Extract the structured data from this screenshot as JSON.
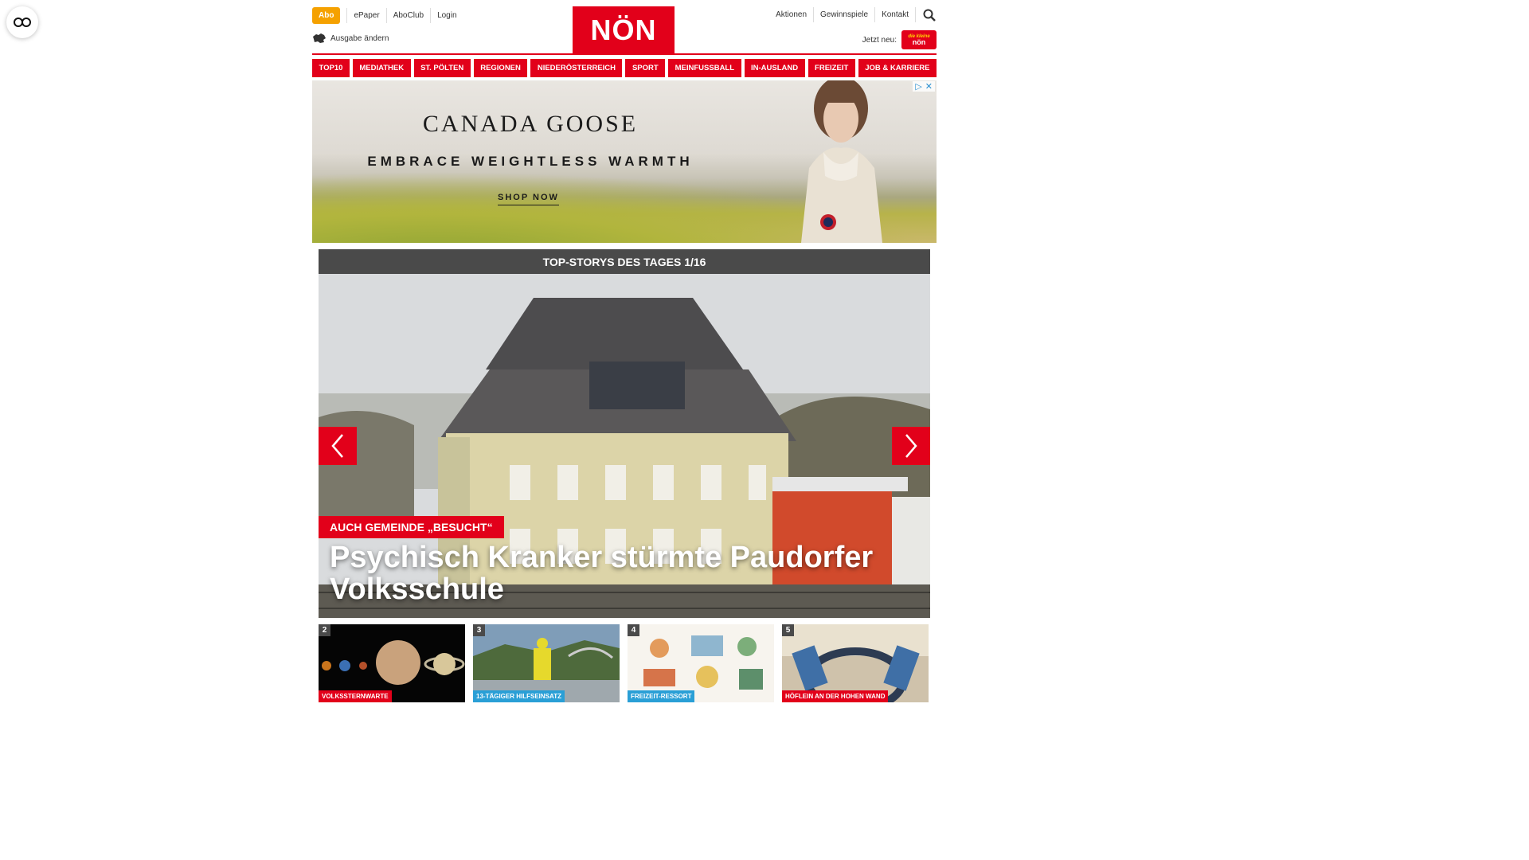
{
  "header": {
    "abo_label": "Abo",
    "left_links": [
      "ePaper",
      "AboClub",
      "Login"
    ],
    "ausgabe_label": "Ausgabe ändern",
    "logo_text": "NÖN",
    "right_links": [
      "Aktionen",
      "Gewinnspiele",
      "Kontakt"
    ],
    "jetzt_label": "Jetzt neu:",
    "mini_logo_top": "die kleine",
    "mini_logo_bottom": "nön"
  },
  "mainnav": [
    "TOP10",
    "MEDIATHEK",
    "ST. PÖLTEN",
    "REGIONEN",
    "NIEDERÖSTERREICH",
    "SPORT",
    "MEINFUSSBALL",
    "IN-AUSLAND",
    "FREIZEIT",
    "JOB & KARRIERE"
  ],
  "ad": {
    "brand": "CANADA GOOSE",
    "tagline": "EMBRACE WEIGHTLESS WARMTH",
    "cta": "SHOP NOW",
    "choices_icon": "ad-choices-icon",
    "close_icon": "close-icon"
  },
  "stories": {
    "heading": "TOP-STORYS DES TAGES 1/16",
    "hero": {
      "kicker": "AUCH GEMEINDE „BESUCHT“",
      "headline": "Psychisch Kranker stürmte Paudorfer Volksschule"
    },
    "teasers": [
      {
        "num": "2",
        "tag": "VOLKSSTERNWARTE",
        "tag_color": "red"
      },
      {
        "num": "3",
        "tag": "13-TÄGIGER HILFSEINSATZ",
        "tag_color": "blue"
      },
      {
        "num": "4",
        "tag": "FREIZEIT-RESSORT",
        "tag_color": "blue"
      },
      {
        "num": "5",
        "tag": "HÖFLEIN AN DER HOHEN WAND",
        "tag_color": "red"
      }
    ]
  },
  "colors": {
    "brand_red": "#e2001a",
    "abo_orange": "#f5a100",
    "story_bar": "#4a4a4a"
  }
}
